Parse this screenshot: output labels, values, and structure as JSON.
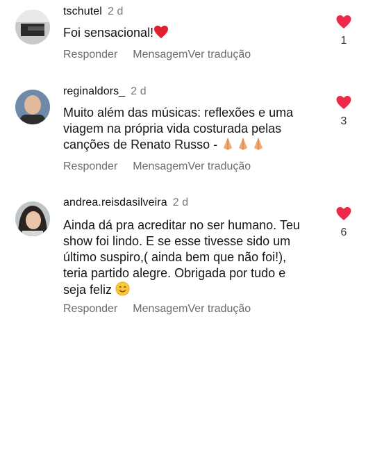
{
  "comments": [
    {
      "username": "tschutel",
      "time": "2 d",
      "text": "Foi sensacional!",
      "emoji": "red-heart",
      "likes": "1",
      "reply_label": "Responder",
      "message_label": "Mensagem",
      "translate_label": "Ver tradução"
    },
    {
      "username": "reginaldors_",
      "time": "2 d",
      "text_lines": [
        "Muito além das músicas: reflexões e uma",
        "viagem na própria vida costurada pelas",
        "canções de Renato Russo -"
      ],
      "emoji": "folded-hands x3",
      "likes": "3",
      "reply_label": "Responder",
      "message_label": "Mensagem",
      "translate_label": "Ver tradução"
    },
    {
      "username": "andrea.reisdasilveira",
      "time": "2 d",
      "text_lines": [
        "Ainda dá pra acreditar no ser humano. Teu",
        "show foi lindo. E se esse tivesse sido um",
        "último suspiro,( ainda bem que não foi!),",
        "teria partido alegre. Obrigada por tudo e",
        "seja feliz"
      ],
      "emoji": "smiling-face",
      "likes": "6",
      "reply_label": "Responder",
      "message_label": "Mensagem",
      "translate_label": "Ver tradução"
    }
  ],
  "colors": {
    "like_heart": "#ee2a4a",
    "username": "#111111",
    "muted": "#6b6b6b"
  }
}
